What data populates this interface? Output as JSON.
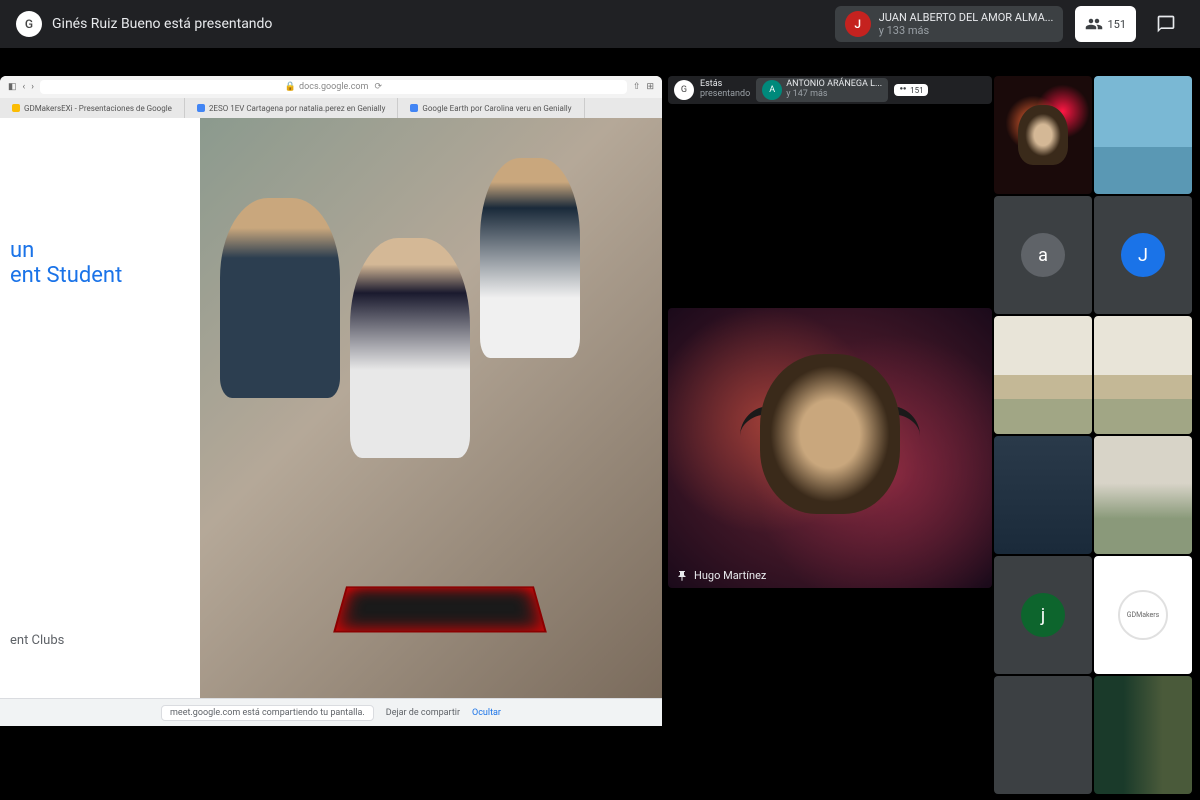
{
  "header": {
    "presenter_name": "Ginés Ruiz Bueno está presentando",
    "attendee_name": "JUAN ALBERTO DEL AMOR ALMA...",
    "attendee_more": "y 133 más",
    "attendee_initial": "J",
    "people_count": "151"
  },
  "browser": {
    "url": "docs.google.com",
    "tabs": [
      "GDMakersEXi - Presentaciones de Google",
      "2ESO 1EV Cartagena por natalia.perez en Genially",
      "Google Earth por Carolina veru en Genially"
    ]
  },
  "slide": {
    "title_line1": "un",
    "title_line2": "ent Student",
    "footer": "ent Clubs"
  },
  "share_banner": {
    "message": "meet.google.com está compartiendo tu pantalla.",
    "stop": "Dejar de compartir",
    "hide": "Ocultar"
  },
  "mini_header": {
    "self_line1": "Estás",
    "self_line2": "presentando",
    "other_name": "ANTONIO ARÁNEGA L...",
    "other_more": "y 147 más",
    "other_initial": "A",
    "count": "151"
  },
  "speaker": {
    "name": "Hugo Martínez"
  },
  "avatars": {
    "a_lower": "a",
    "j_upper": "J",
    "j_lower": "j"
  },
  "logo_text": "GDMakers"
}
